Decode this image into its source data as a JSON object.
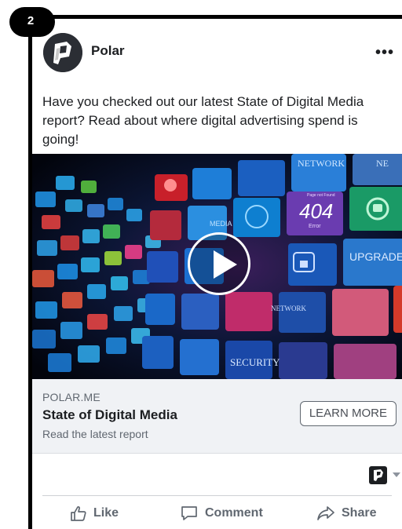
{
  "step_number": "2",
  "post": {
    "page_name": "Polar",
    "more_label": "•••",
    "text": "Have you checked out our latest State of Digital Media report? Read about where digital advertising spend is going!"
  },
  "link_preview": {
    "domain": "POLAR.ME",
    "title": "State of Digital Media",
    "description": "Read the latest report",
    "cta_label": "LEARN MORE"
  },
  "media_overlay_text": {
    "network_top": "NETWORK",
    "network_top_right": "NE",
    "error_code": "404",
    "page_not_found": "Page not Found",
    "error": "Error",
    "upgrade": "UPGRADE",
    "network_mid": "NETWORK",
    "security": "SECURITY",
    "media": "MEDIA"
  },
  "actions": {
    "like": "Like",
    "comment": "Comment",
    "share": "Share"
  },
  "colors": {
    "primary_text": "#1c1e21",
    "secondary_text": "#606770",
    "link_box_bg": "#f0f2f5",
    "border": "#000000"
  }
}
